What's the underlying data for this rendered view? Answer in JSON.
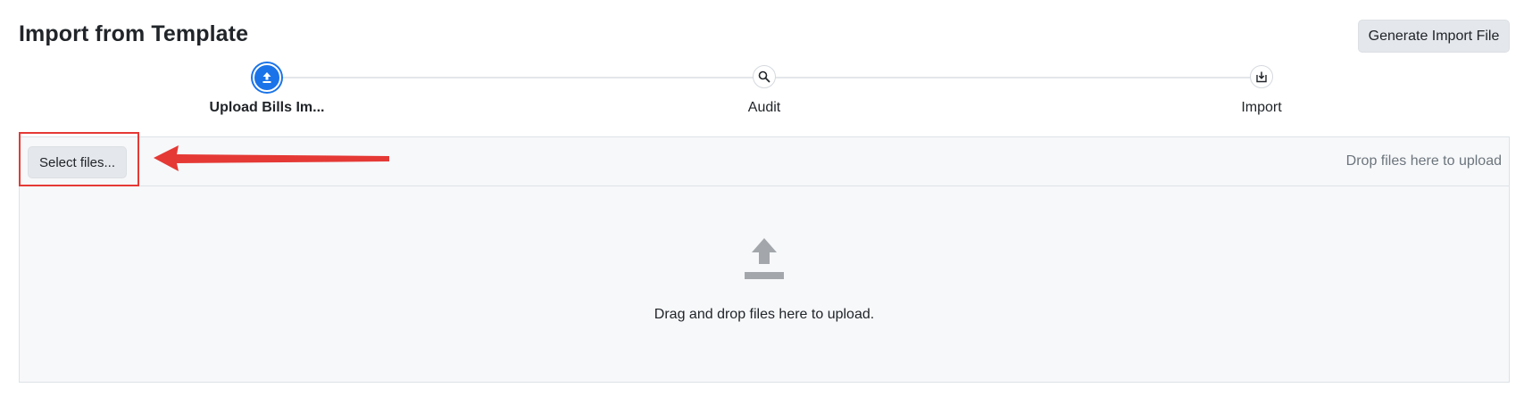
{
  "header": {
    "title": "Import from Template",
    "generate_button_label": "Generate Import File"
  },
  "stepper": {
    "steps": [
      {
        "label": "Upload Bills Im...",
        "icon": "upload-icon",
        "active": true
      },
      {
        "label": "Audit",
        "icon": "search-icon",
        "active": false
      },
      {
        "label": "Import",
        "icon": "import-icon",
        "active": false
      }
    ]
  },
  "upload": {
    "select_button_label": "Select files...",
    "drop_hint": "Drop files here to upload",
    "drop_icon": "upload-arrow-icon",
    "drag_text": "Drag and drop files here to upload."
  },
  "annotation": {
    "highlight_color": "#e53935",
    "arrow_color": "#e53935"
  },
  "colors": {
    "accent": "#1a73e8",
    "panel_bg": "#f7f8fa",
    "button_bg": "#e4e7eb"
  }
}
